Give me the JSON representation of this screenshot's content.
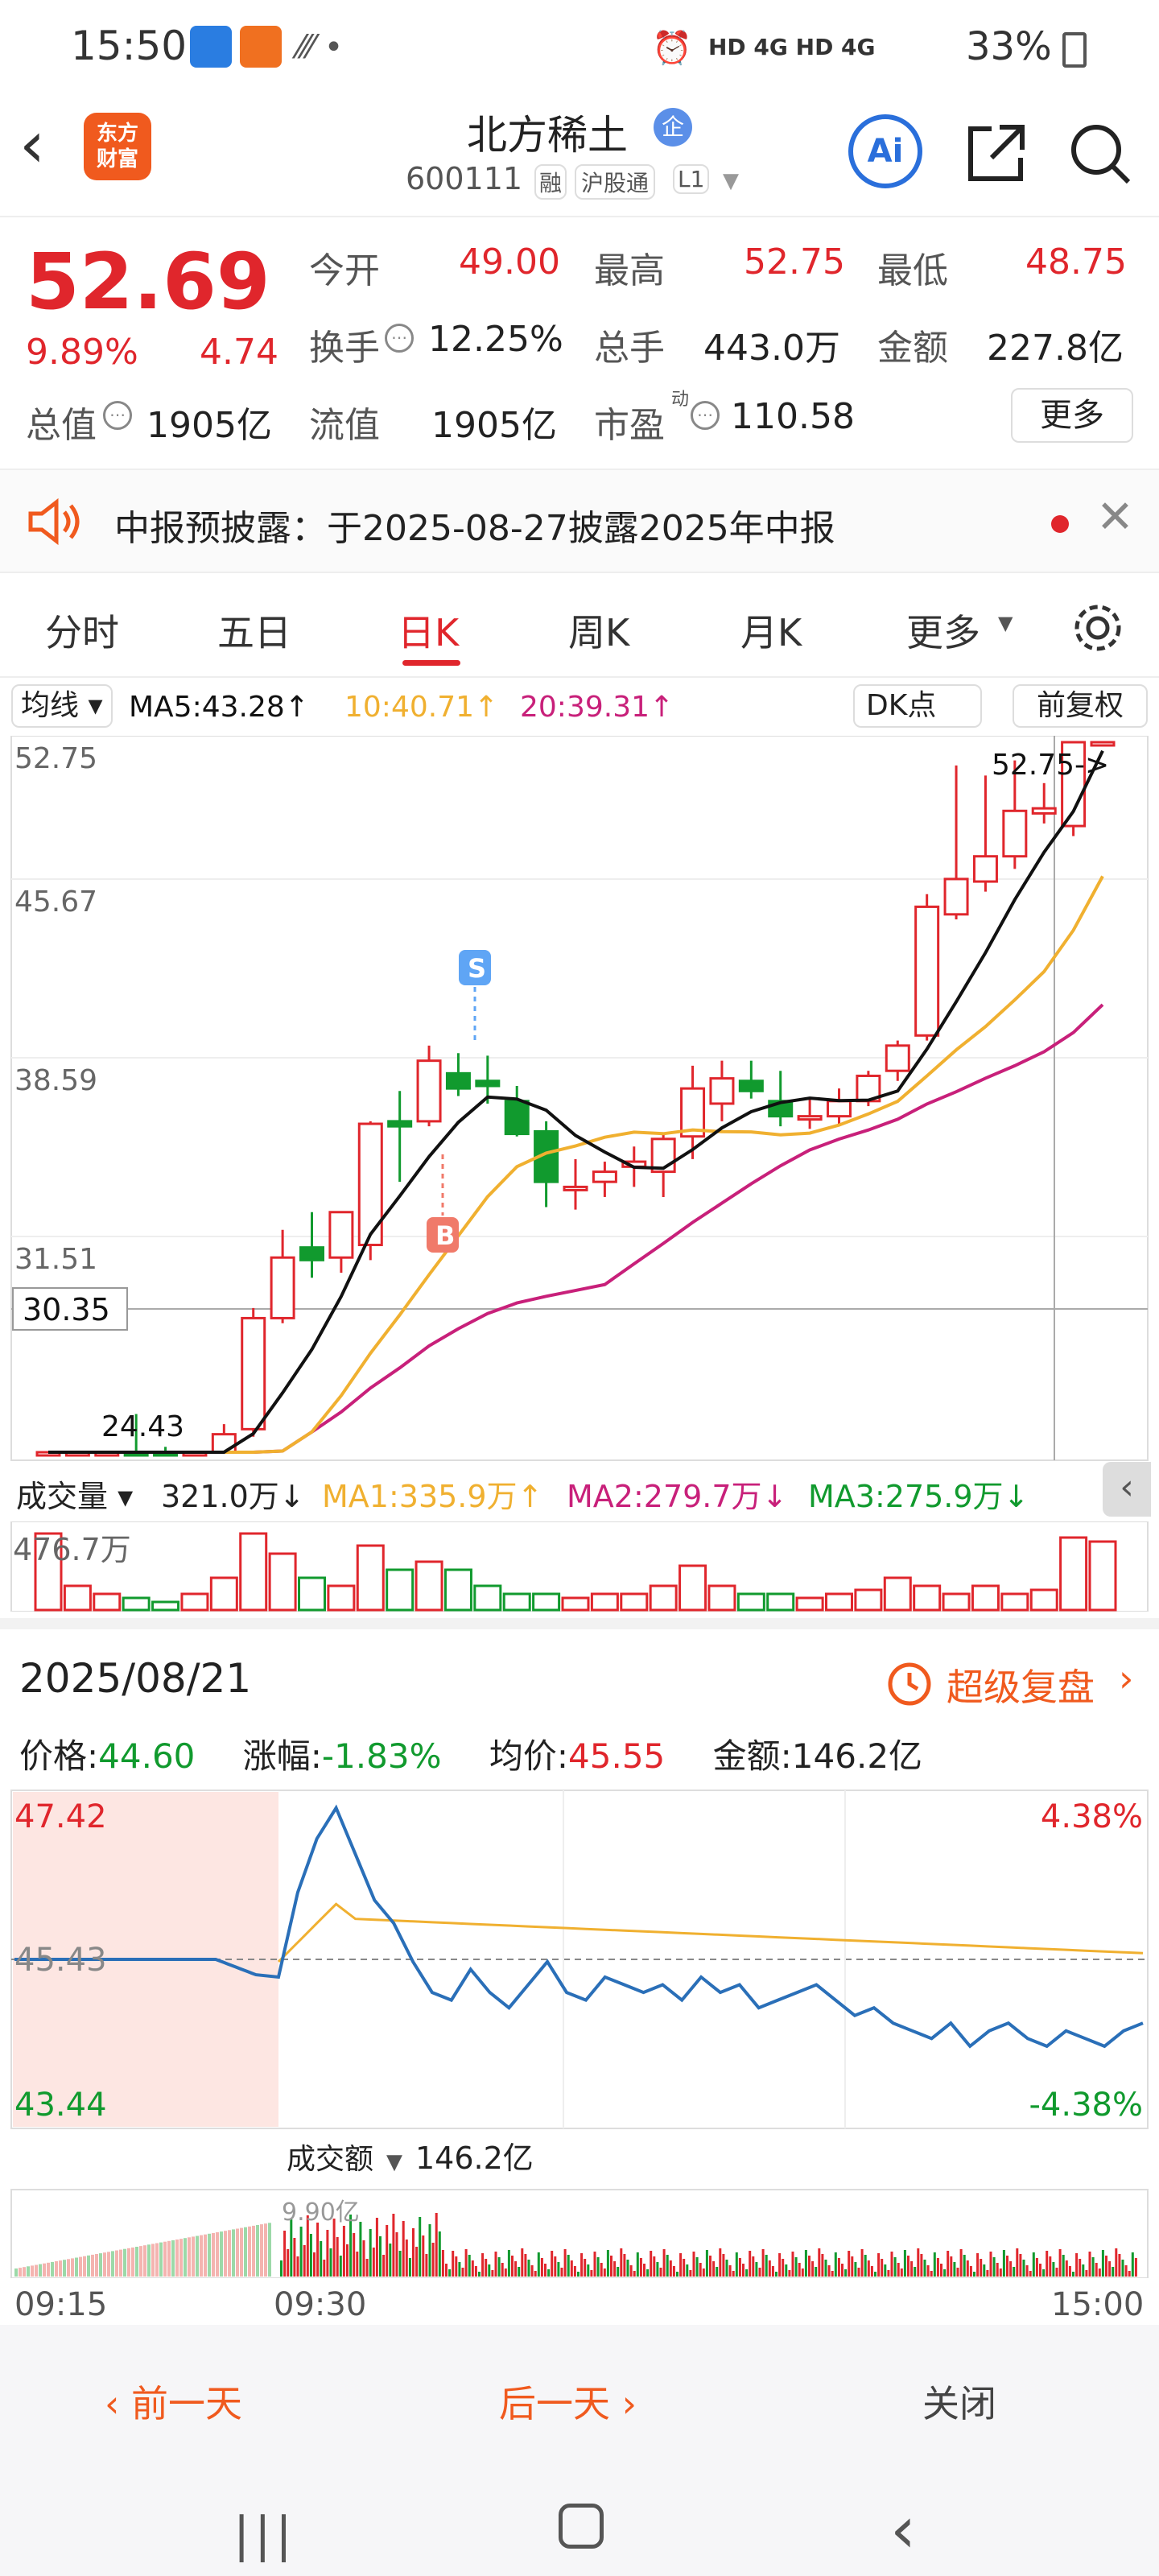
{
  "status": {
    "time": "15:50",
    "network": "HD 4G HD 4G",
    "battery": "33%"
  },
  "header": {
    "logo_text_top": "东方",
    "logo_text_bottom": "财富",
    "stock_name": "北方稀土",
    "badge": "企",
    "code": "600111",
    "tag_margin": "融",
    "tag_connect": "沪股通",
    "tag_level": "L1",
    "ai_label": "Ai"
  },
  "quote": {
    "price": "52.69",
    "change_pct": "9.89%",
    "change": "4.74",
    "open_label": "今开",
    "open": "49.00",
    "high_label": "最高",
    "high": "52.75",
    "low_label": "最低",
    "low": "48.75",
    "turnover_label": "换手",
    "turnover": "12.25%",
    "volume_label": "总手",
    "volume": "443.0万",
    "amount_label": "金额",
    "amount": "227.8亿",
    "mktcap_label": "总值",
    "mktcap": "1905亿",
    "float_label": "流值",
    "float": "1905亿",
    "pe_label": "市盈",
    "pe_sup": "动",
    "pe": "110.58",
    "more_label": "更多"
  },
  "notice": {
    "text": "中报预披露：于2025-08-27披露2025年中报"
  },
  "tabs": [
    "分时",
    "五日",
    "日K",
    "周K",
    "月K",
    "更多"
  ],
  "kline_header": {
    "indicator": "均线",
    "ma5": "MA5:43.28",
    "ma10": "10:40.71",
    "ma20": "20:39.31",
    "dk": "DK点",
    "adjust": "前复权"
  },
  "kline_axis": {
    "y1": "52.75",
    "y2": "45.67",
    "y3": "38.59",
    "y4": "31.51",
    "crosshair": "30.35",
    "low_mark": "24.43",
    "high_mark": "52.75->",
    "buy": "B",
    "sell": "S"
  },
  "volume_header": {
    "label": "成交量",
    "value": "321.0万",
    "ma1": "MA1:335.9万",
    "ma2": "MA2:279.7万",
    "ma3": "MA3:275.9万",
    "axis_top": "476.7万"
  },
  "replay": {
    "date": "2025/08/21",
    "super_replay": "超级复盘",
    "price_label": "价格:",
    "price": "44.60",
    "chg_label": "涨幅:",
    "chg": "-1.83%",
    "avg_label": "均价:",
    "avg": "45.55",
    "amount_label": "金额:",
    "amount": "146.2亿",
    "y_top": "47.42",
    "y_mid": "45.43",
    "y_bot": "43.44",
    "pct_top": "4.38%",
    "pct_bot": "-4.38%",
    "vol_label": "成交额",
    "vol_value": "146.2亿",
    "vol_axis": "9.90亿",
    "t_start": "09:15",
    "t_open": "09:30",
    "t_end": "15:00"
  },
  "footer": {
    "prev": "前一天",
    "next": "后一天",
    "close": "关闭"
  },
  "colors": {
    "up": "#e0262c",
    "down": "#119a2e",
    "ma5": "#000000",
    "ma10": "#f0b030",
    "ma20": "#c8207a",
    "accent": "#f05a1e"
  }
}
